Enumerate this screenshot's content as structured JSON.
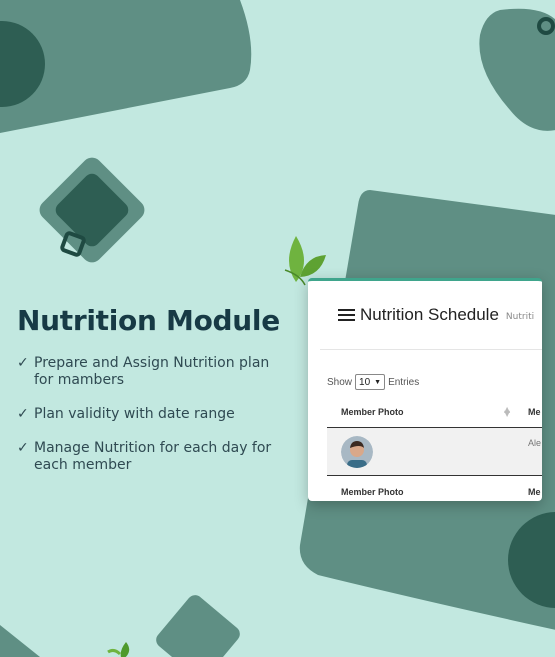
{
  "feature": {
    "title": "Nutrition Module",
    "check_glyph": "✓",
    "items": [
      {
        "line1": "Prepare and Assign Nutrition plan",
        "line2": "for mambers"
      },
      {
        "line1": "Plan validity with date range",
        "line2": ""
      },
      {
        "line1": "Manage Nutrition for each day for",
        "line2": "each member"
      }
    ]
  },
  "app": {
    "title": "Nutrition Schedule",
    "breadcrumb": "Nutriti",
    "menu_icon": "hamburger-icon",
    "show_label": "Show",
    "entries_value": "10",
    "entries_label": "Entries",
    "columns": {
      "photo": "Member Photo",
      "name": "Me"
    },
    "rows": [
      {
        "name": "Ale"
      }
    ],
    "footer_columns": {
      "photo": "Member Photo",
      "name": "Me"
    }
  },
  "colors": {
    "background": "#c2e8e0",
    "shape_dark": "#2e5e53",
    "shape_mid": "#5f8f84",
    "accent": "#3fa58c",
    "leaf": "#6fb33f",
    "title": "#173a45"
  }
}
